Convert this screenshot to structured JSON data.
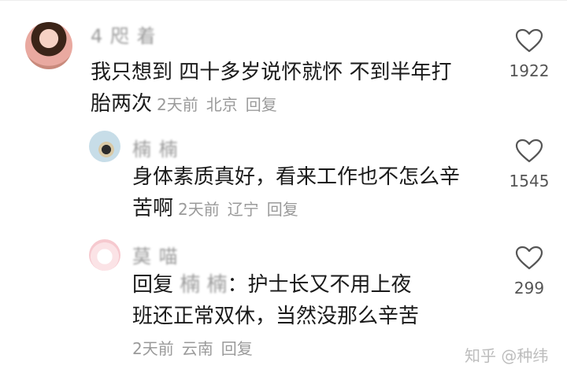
{
  "comments": [
    {
      "username": "4 咫 着",
      "lines": [
        "我只想到 四十多岁说怀就怀 不到半年打",
        "胎两次"
      ],
      "time": "2天前",
      "location": "北京",
      "reply_label": "回复",
      "likes": "1922"
    },
    {
      "username": "楠 楠",
      "lines": [
        "身体素质真好，看来工作也不怎么辛",
        "苦啊"
      ],
      "time": "2天前",
      "location": "辽宁",
      "reply_label": "回复",
      "likes": "1545"
    },
    {
      "username": "莫 喵",
      "reply_prefix": "回复",
      "mention": "楠 楠",
      "lines": [
        "：护士长又不用上夜",
        "班还正常双休，当然没那么辛苦"
      ],
      "time": "2天前",
      "location": "云南",
      "reply_label": "回复",
      "likes": "299"
    }
  ],
  "watermark": "知乎 @种纬",
  "colors": {
    "text": "#1a1a1a",
    "meta": "#9a9a9a",
    "like_icon": "#555555"
  },
  "icons": {
    "like": "heart-outline-icon"
  }
}
